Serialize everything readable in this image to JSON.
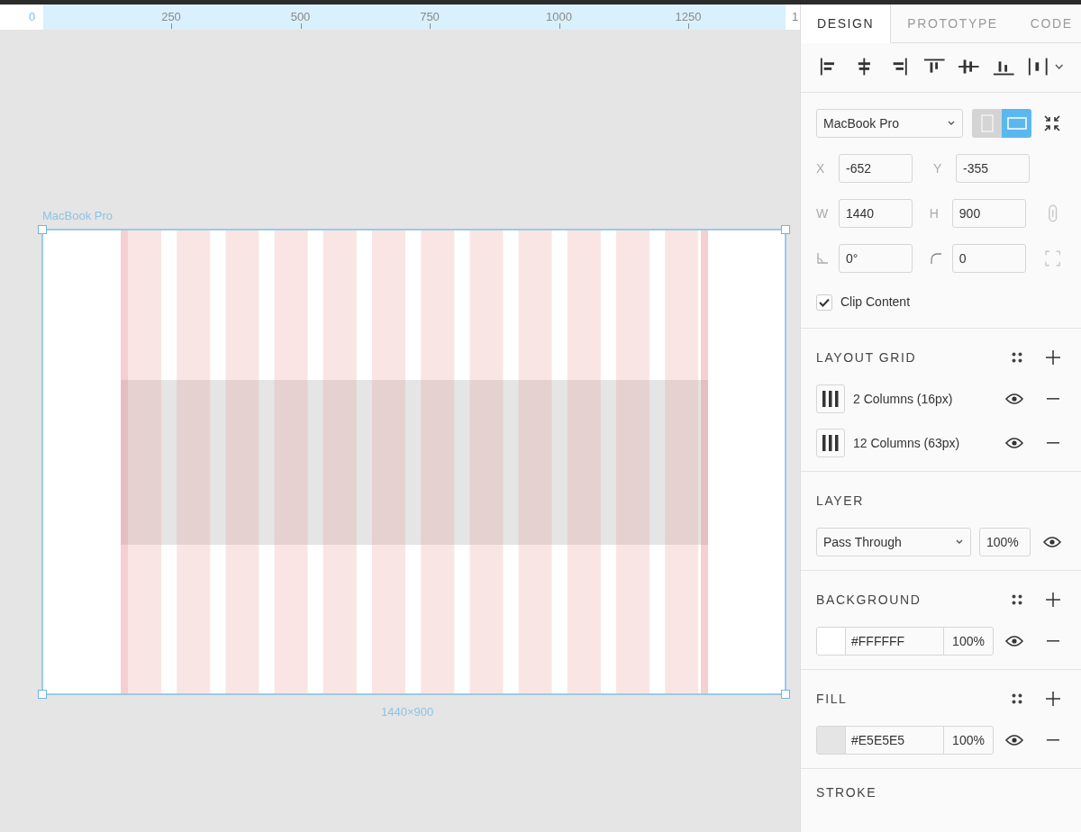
{
  "ruler": {
    "ticks": [
      "0",
      "250",
      "500",
      "750",
      "1000",
      "1250",
      "1"
    ]
  },
  "frame": {
    "label": "MacBook Pro",
    "size": "1440×900"
  },
  "tabs": [
    {
      "label": "DESIGN",
      "selected": true
    },
    {
      "label": "PROTOTYPE",
      "selected": false
    },
    {
      "label": "CODE",
      "selected": false
    }
  ],
  "device": {
    "preset": "MacBook Pro",
    "orientations": [
      {
        "kind": "portrait",
        "selected": false
      },
      {
        "kind": "landscape",
        "selected": true
      }
    ]
  },
  "fields": [
    {
      "kind": "label",
      "label": "X",
      "value": "-652"
    },
    {
      "kind": "label",
      "label": "Y",
      "value": "-355"
    },
    {
      "kind": "label",
      "label": "W",
      "value": "1440"
    },
    {
      "kind": "label",
      "label": "H",
      "value": "900"
    },
    {
      "kind": "rotation",
      "value": "0°"
    },
    {
      "kind": "radius",
      "value": "0"
    }
  ],
  "clip_content": {
    "label": "Clip Content",
    "checked": true
  },
  "layout_grid": {
    "title": "LAYOUT GRID",
    "grids": [
      {
        "label": "2 Columns (16px)"
      },
      {
        "label": "12 Columns (63px)"
      }
    ]
  },
  "layer": {
    "title": "LAYER",
    "blend": "Pass Through",
    "opacity": "100%"
  },
  "background": {
    "title": "BACKGROUND",
    "hex": "#FFFFFF",
    "opacity": "100%"
  },
  "fill": {
    "title": "FILL",
    "hex": "#E5E5E5",
    "opacity": "100%"
  },
  "stroke": {
    "title": "STROKE"
  }
}
